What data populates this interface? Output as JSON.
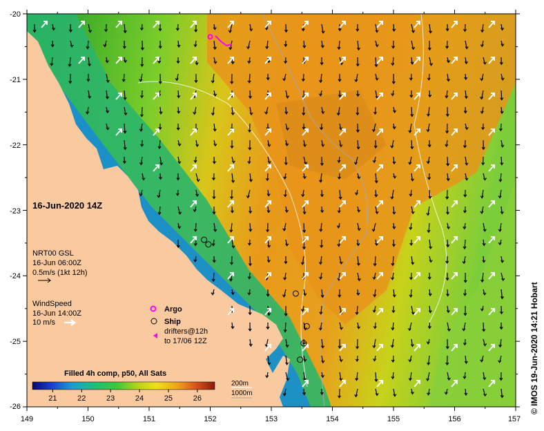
{
  "map": {
    "date_title": "16-Jun-2020 14Z",
    "credit": "© IMOS 19-Jun-2020 14:21 Hobart",
    "lon_ticks": [
      "149",
      "150",
      "151",
      "152",
      "153",
      "154",
      "155",
      "156",
      "157"
    ],
    "lat_ticks": [
      "-20",
      "-21",
      "-22",
      "-23",
      "-24",
      "-25",
      "-26"
    ],
    "lon_range": [
      149,
      157
    ],
    "lat_range": [
      -26,
      -20
    ]
  },
  "currents_legend": {
    "source": "NRT00 GSL",
    "time": "16-Jun 06:00Z",
    "scale": "0.5m/s (1kt 12h)"
  },
  "wind_legend": {
    "label": "WindSpeed",
    "time": "16-Jun 14:00Z",
    "scale": "10 m/s"
  },
  "symbols_legend": {
    "argo": "Argo",
    "ship": "Ship",
    "drifters_line1": "drifters@12h",
    "drifters_line2": "to 17/06 12Z"
  },
  "colorbar": {
    "title": "Filled 4h comp, p50, All Sats",
    "ticks": [
      "21",
      "22",
      "23",
      "24",
      "25",
      "26"
    ],
    "range": [
      20.3,
      26.6
    ]
  },
  "isobaths": {
    "shallow": "200m",
    "deep": "1000m"
  },
  "colors": {
    "land": "#f9c9a0",
    "sst_warm": "#e89a1a",
    "sst_cool": "#2a9d2e",
    "argo": "#ff00ff",
    "wind_arrow": "#ffffff",
    "current_arrow": "#000000"
  },
  "ships": [
    {
      "lon": 151.9,
      "lat": -23.45
    },
    {
      "lon": 151.97,
      "lat": -23.52
    },
    {
      "lon": 153.4,
      "lat": -24.27
    },
    {
      "lon": 153.58,
      "lat": -24.77
    },
    {
      "lon": 153.53,
      "lat": -25.03
    },
    {
      "lon": 153.47,
      "lat": -25.28
    }
  ],
  "argo_floats": [
    {
      "lon": 152.0,
      "lat": -20.35
    }
  ]
}
